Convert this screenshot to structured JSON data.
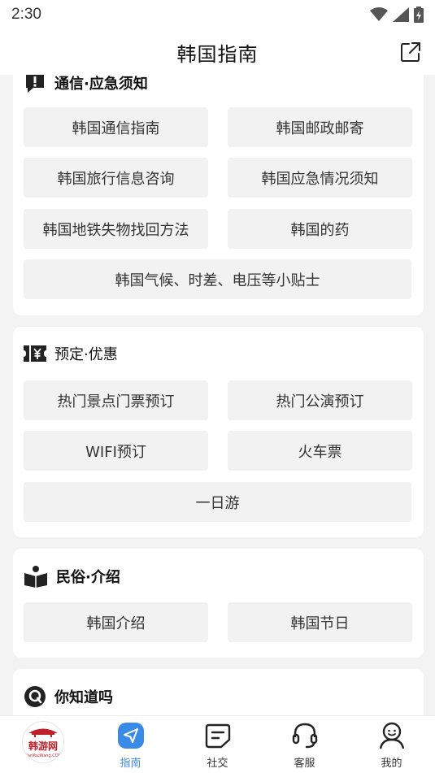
{
  "status": {
    "time": "2:30"
  },
  "header": {
    "title": "韩国指南"
  },
  "sections": {
    "telecom": {
      "title": "通信·应急须知",
      "items": [
        "韩国通信指南",
        "韩国邮政邮寄",
        "韩国旅行信息咨询",
        "韩国应急情况须知",
        "韩国地铁失物找回方法",
        "韩国的药",
        "韩国气候、时差、电压等小贴士"
      ]
    },
    "booking": {
      "title": "预定·优惠",
      "items": [
        "热门景点门票预订",
        "热门公演预订",
        "WIFI预订",
        "火车票",
        "一日游"
      ]
    },
    "culture": {
      "title": "民俗·介绍",
      "items": [
        "韩国介绍",
        "韩国节日"
      ]
    },
    "didyouknow": {
      "title": "你知道吗"
    }
  },
  "bottom_nav": {
    "logo": {
      "text": "韩游网",
      "sub": "HanYouWang.COM"
    },
    "items": [
      {
        "label": "指南",
        "icon": "guide-navigation-icon",
        "active": true
      },
      {
        "label": "社交",
        "icon": "chat-note-icon"
      },
      {
        "label": "客服",
        "icon": "headset-icon"
      },
      {
        "label": "我的",
        "icon": "user-profile-icon"
      }
    ]
  },
  "colors": {
    "accent": "#3a8be8",
    "card_bg": "#ffffff",
    "page_bg": "#f3f3f3",
    "button_bg": "#f2f2f2"
  }
}
